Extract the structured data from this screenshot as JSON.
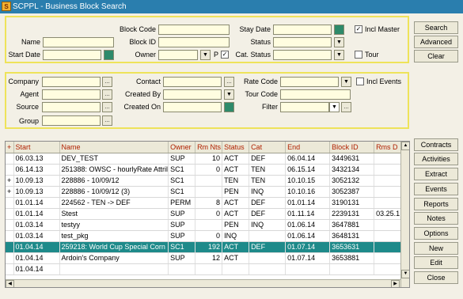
{
  "window": {
    "title": "SCPPL - Business Block Search"
  },
  "search_panel": {
    "block_code_label": "Block Code",
    "name_label": "Name",
    "block_id_label": "Block ID",
    "start_date_label": "Start Date",
    "owner_label": "Owner",
    "owner_p_label": "P",
    "stay_date_label": "Stay Date",
    "status_label": "Status",
    "cat_status_label": "Cat. Status",
    "incl_master_label": "Incl Master",
    "tour_label": "Tour"
  },
  "filter_panel": {
    "company_label": "Company",
    "agent_label": "Agent",
    "source_label": "Source",
    "group_label": "Group",
    "contact_label": "Contact",
    "created_by_label": "Created By",
    "created_on_label": "Created On",
    "rate_code_label": "Rate Code",
    "tour_code_label": "Tour Code",
    "filter_label": "Filter",
    "incl_events_label": "Incl Events"
  },
  "top_buttons": [
    "Search",
    "Advanced",
    "Clear"
  ],
  "side_buttons": [
    "Contracts",
    "Activities",
    "Extract",
    "Events",
    "Reports",
    "Notes",
    "Options",
    "New",
    "Edit",
    "Close"
  ],
  "results": {
    "columns": [
      "+",
      "Start",
      "Name",
      "Owner",
      "Rm Nts",
      "Status",
      "Cat",
      "End",
      "Block ID",
      "Rms D"
    ],
    "rows": [
      [
        "",
        "06.03.13",
        "DEV_TEST",
        "SUP",
        "10",
        "ACT",
        "DEF",
        "06.04.14",
        "3449631",
        ""
      ],
      [
        "",
        "06.14.13",
        "251388: OWSC - hourlyRate Attril",
        "SC1",
        "0",
        "ACT",
        "TEN",
        "06.15.14",
        "3432134",
        ""
      ],
      [
        "+",
        "10.09.13",
        "228886 - 10/09/12",
        "SC1",
        "",
        "TEN",
        "TEN",
        "10.10.15",
        "3052132",
        ""
      ],
      [
        "+",
        "10.09.13",
        "228886 - 10/09/12 (3)",
        "SC1",
        "",
        "PEN",
        "INQ",
        "10.10.16",
        "3052387",
        ""
      ],
      [
        "",
        "01.01.14",
        "224562 - TEN -> DEF",
        "PERM",
        "8",
        "ACT",
        "DEF",
        "01.01.14",
        "3190131",
        ""
      ],
      [
        "",
        "01.01.14",
        "Stest",
        "SUP",
        "0",
        "ACT",
        "DEF",
        "01.11.14",
        "2239131",
        "03.25.1"
      ],
      [
        "",
        "01.03.14",
        "testyy",
        "SUP",
        "",
        "PEN",
        "INQ",
        "01.06.14",
        "3647881",
        ""
      ],
      [
        "",
        "01.03.14",
        "test_pkg",
        "SUP",
        "0",
        "INQ",
        "",
        "01.06.14",
        "3648131",
        ""
      ],
      [
        "",
        "01.04.14",
        "259218: World Cup Special Corn",
        "SC1",
        "192",
        "ACT",
        "DEF",
        "01.07.14",
        "3653631",
        ""
      ],
      [
        "",
        "01.04.14",
        "Ardoin's Company",
        "SUP",
        "12",
        "ACT",
        "",
        "01.07.14",
        "3653881",
        ""
      ],
      [
        "",
        "01.04.14",
        "",
        "",
        "",
        "",
        "",
        "",
        "",
        ""
      ]
    ],
    "selected_row": 8
  },
  "colors": {
    "title_bar": "#2a7eae",
    "panel_border": "#eee35a",
    "field_bg": "#fffde0",
    "selected_row": "#1e8a8a",
    "header_text": "#b02000"
  },
  "icons": [
    "calendar-icon",
    "dropdown-arrow-icon",
    "ellipsis-icon"
  ]
}
